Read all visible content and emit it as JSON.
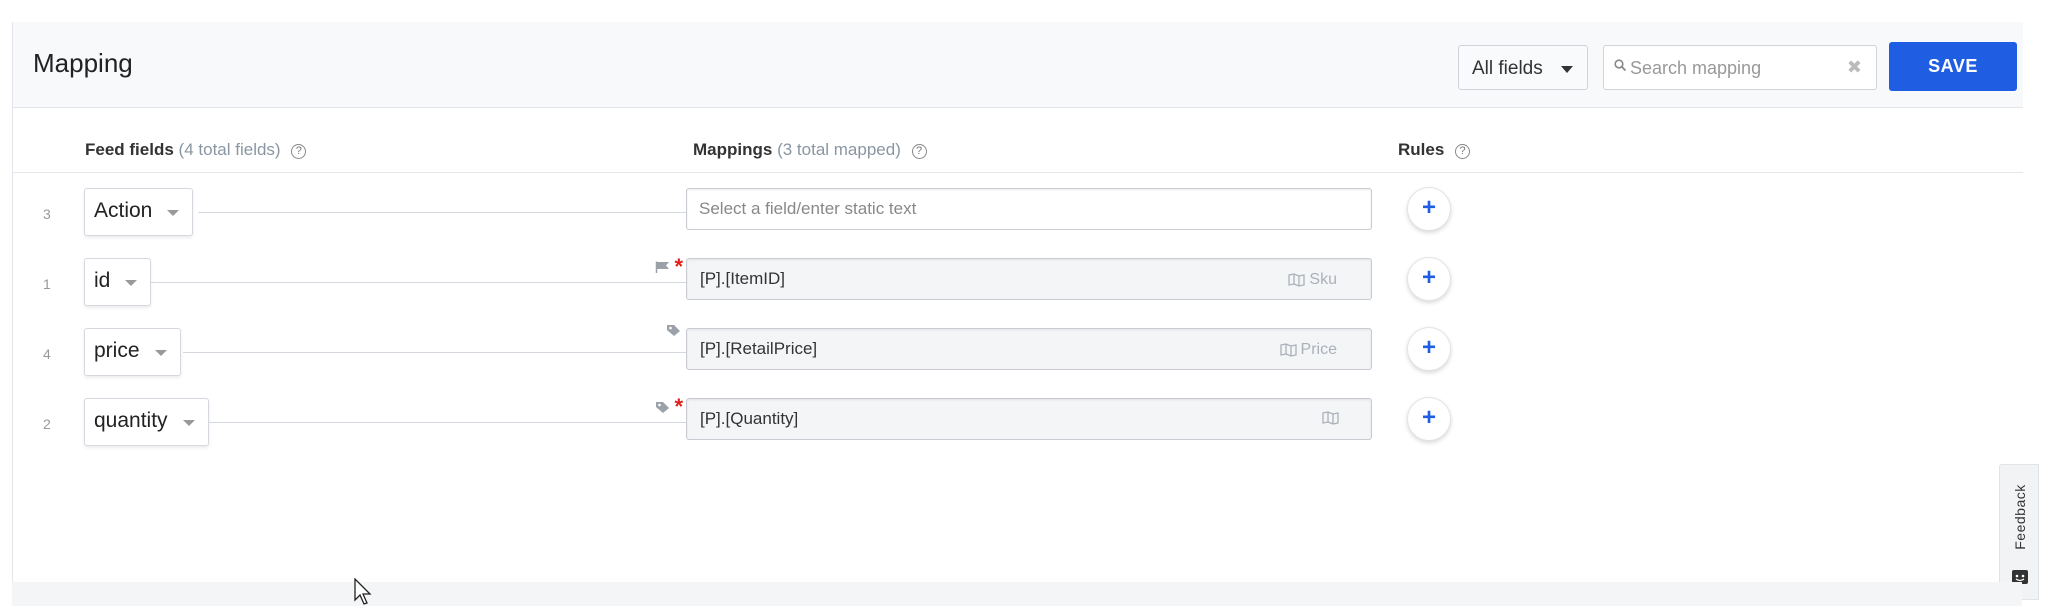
{
  "header": {
    "title": "Mapping",
    "filter_label": "All fields",
    "search_placeholder": "Search mapping",
    "save_label": "SAVE"
  },
  "columns": {
    "feed_fields": {
      "label": "Feed fields",
      "sub": "(4 total fields)"
    },
    "mappings": {
      "label": "Mappings",
      "sub": "(3 total mapped)"
    },
    "rules": {
      "label": "Rules"
    }
  },
  "rows": [
    {
      "num": "3",
      "field": "Action",
      "mapping": "",
      "mapping_placeholder": "Select a field/enter static text",
      "tag": "",
      "required": false,
      "marker": "none"
    },
    {
      "num": "1",
      "field": "id",
      "mapping": "[P].[ItemID]",
      "tag": "Sku",
      "required": true,
      "marker": "flag-icon"
    },
    {
      "num": "4",
      "field": "price",
      "mapping": "[P].[RetailPrice]",
      "tag": "Price",
      "required": false,
      "marker": "tag-icon"
    },
    {
      "num": "2",
      "field": "quantity",
      "mapping": "[P].[Quantity]",
      "tag": "",
      "required": true,
      "marker": "tag-icon"
    }
  ],
  "required_mark": "*",
  "add_rule_label": "+",
  "feedback_label": "Feedback",
  "colors": {
    "accent": "#1f5ee3",
    "required": "#e0201c",
    "muted": "#8a96a3"
  }
}
